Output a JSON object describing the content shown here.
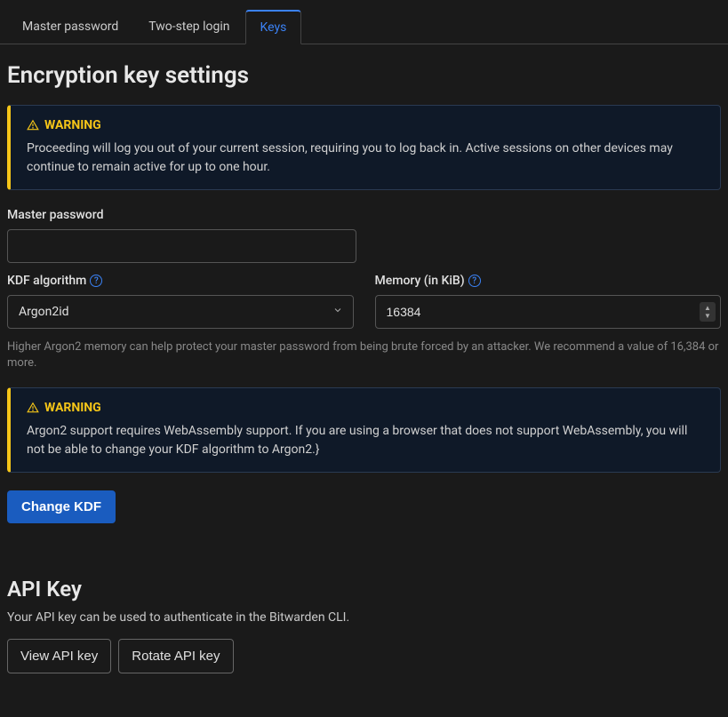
{
  "tabs": {
    "master_password": "Master password",
    "two_step_login": "Two-step login",
    "keys": "Keys"
  },
  "encryption": {
    "heading": "Encryption key settings",
    "warning1": {
      "title": "WARNING",
      "body": "Proceeding will log you out of your current session, requiring you to log back in. Active sessions on other devices may continue to remain active for up to one hour."
    },
    "master_password_label": "Master password",
    "master_password_value": "",
    "kdf_label": "KDF algorithm",
    "kdf_value": "Argon2id",
    "memory_label": "Memory (in KiB)",
    "memory_value": "16384",
    "memory_help": "Higher Argon2 memory can help protect your master password from being brute forced by an attacker. We recommend a value of 16,384 or more.",
    "warning2": {
      "title": "WARNING",
      "body": "Argon2 support requires WebAssembly support. If you are using a browser that does not support WebAssembly, you will not be able to change your KDF algorithm to Argon2.}"
    },
    "change_kdf_button": "Change KDF"
  },
  "api": {
    "heading": "API Key",
    "description": "Your API key can be used to authenticate in the Bitwarden CLI.",
    "view_button": "View API key",
    "rotate_button": "Rotate API key"
  }
}
